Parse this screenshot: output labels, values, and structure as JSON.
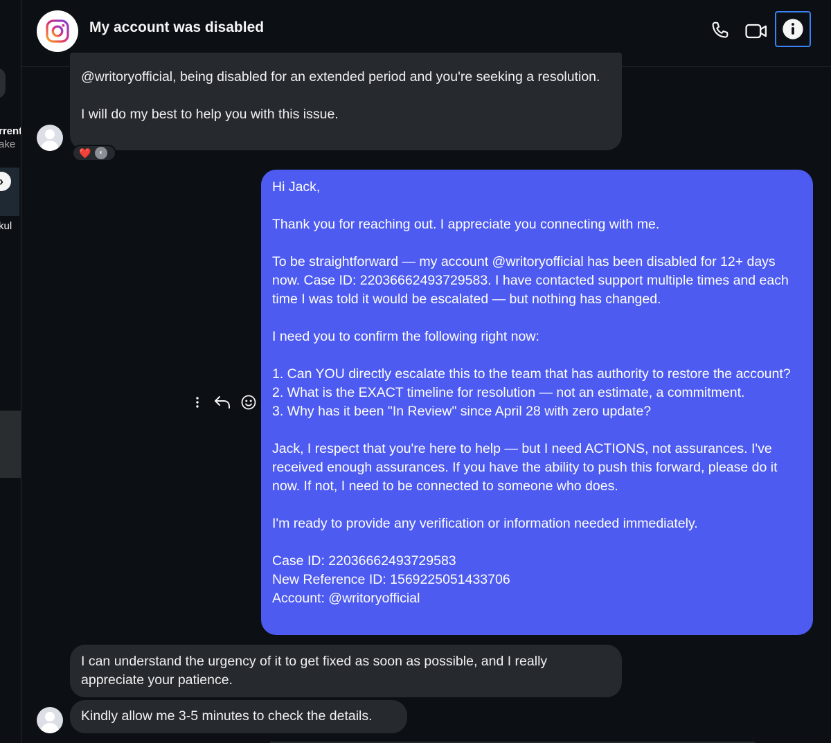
{
  "sidebar": {
    "text_1": "rrent",
    "text_2": "ake",
    "text_3": "kul"
  },
  "header": {
    "title": "My account was disabled",
    "app_icon": "instagram-logo-icon",
    "buttons": [
      "phone-icon",
      "video-icon",
      "info-icon"
    ]
  },
  "messages": [
    {
      "sender": "them",
      "text": "@writoryofficial, being disabled for an extended period and you're seeking a resolution.\n\nI will do my best to help you with this issue.",
      "reactions": [
        "❤️"
      ]
    },
    {
      "sender": "me",
      "text": "Hi Jack,\n\nThank you for reaching out. I appreciate you connecting with me.\n\nTo be straightforward — my account @writoryofficial has been disabled for 12+ days now. Case ID: 22036662493729583. I have contacted support multiple times and each time I was told it would be escalated — but nothing has changed.\n\nI need you to confirm the following right now:\n\n1. Can YOU directly escalate this to the team that has authority to restore the account?\n2. What is the EXACT timeline for resolution — not an estimate, a commitment.\n3. Why has it been \"In Review\" since April 28 with zero update?\n\nJack, I respect that you're here to help — but I need ACTIONS, not assurances. I've received enough assurances. If you have the ability to push this forward, please do it now. If not, I need to be connected to someone who does.\n\nI'm ready to provide any verification or information needed immediately.\n\nCase ID: 22036662493729583\nNew Reference ID: 1569225051433706\nAccount: @writoryofficial"
    },
    {
      "sender": "them",
      "text": "I can understand the urgency of it to get fixed as soon as possible, and I really appreciate your patience."
    },
    {
      "sender": "them",
      "text": "Kindly allow me 3-5 minutes to check the details."
    }
  ],
  "message_actions": [
    "more-options-icon",
    "reply-icon",
    "emoji-icon"
  ],
  "colors": {
    "background": "#0c1014",
    "incoming_bubble": "#262a2f",
    "outgoing_bubble": "#4d5bf0",
    "focus_ring": "#3b82f6"
  }
}
